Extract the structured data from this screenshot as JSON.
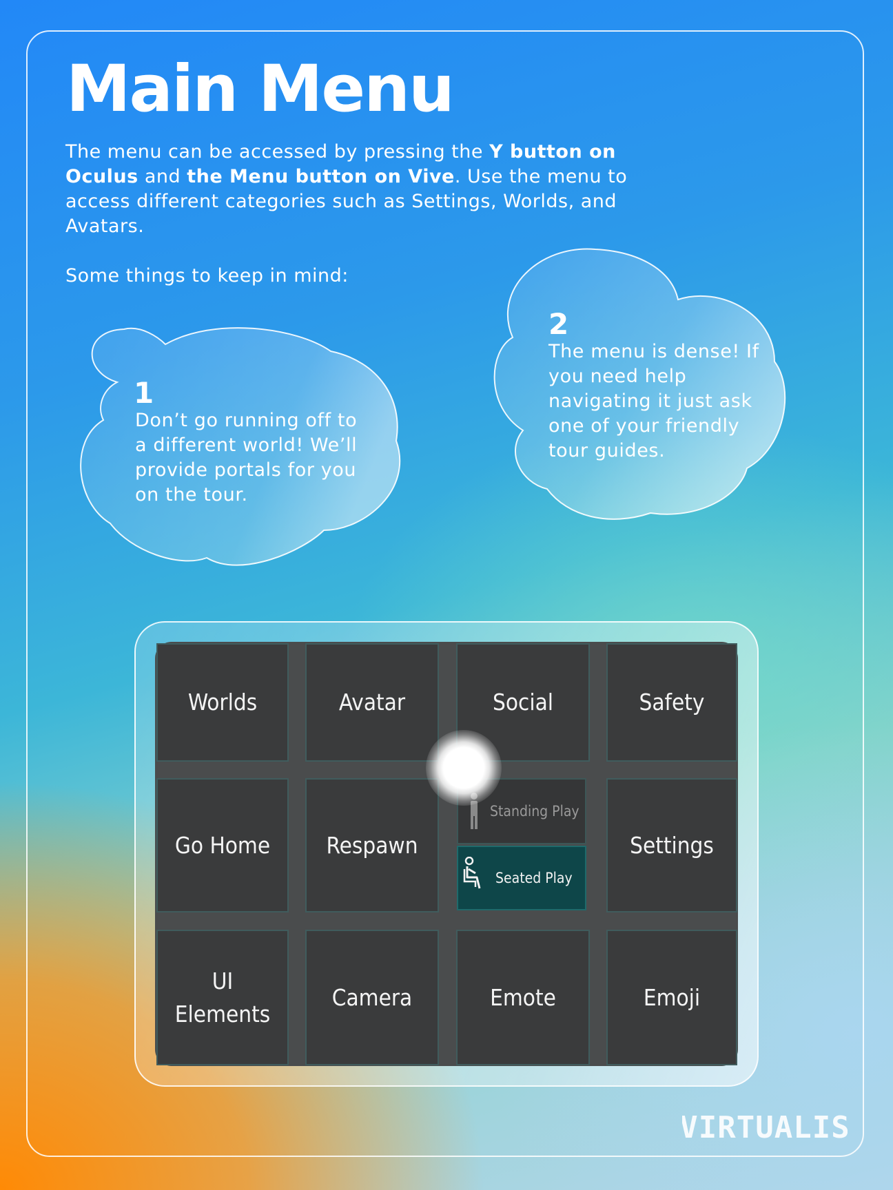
{
  "page": {
    "title": "Main Menu",
    "intro": {
      "p1": "The menu can be accessed by pressing the ",
      "b1": "Y button on Oculus",
      "p2": " and ",
      "b2": "the Menu button on Vive",
      "p3": ". Use the menu to access different categories such as Settings, Worlds, and Avatars."
    },
    "keep_in_mind": "Some things to keep in mind:"
  },
  "tips": [
    {
      "number": "1",
      "text": "Don’t go running off to a different world! We’ll provide portals for you on the tour."
    },
    {
      "number": "2",
      "text": "The menu is dense! If you need help navigating it just ask one of your friendly tour guides."
    }
  ],
  "menu": {
    "row1": [
      "Worlds",
      "Avatar",
      "Social",
      "Safety"
    ],
    "row2": [
      "Go Home",
      "Respawn",
      "Settings"
    ],
    "row3": [
      "UI",
      "Elements",
      "Camera",
      "Emote",
      "Emoji"
    ],
    "play_modes": {
      "standing": "Standing Play",
      "seated": "Seated Play"
    }
  },
  "brand": {
    "logo_text": "VIRTUALIS"
  },
  "colors": {
    "tile": "#3a3b3c",
    "seated_selected": "#0e4649",
    "orange": "#ff8a05",
    "blue": "#2288f7"
  }
}
